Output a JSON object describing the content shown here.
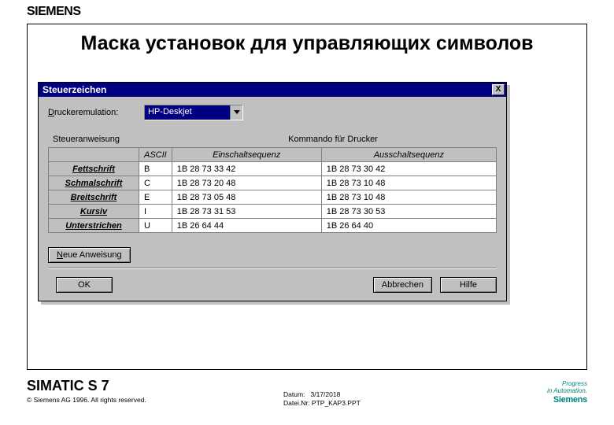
{
  "brand": "SIEMENS",
  "slide_title": "Маска установок для управляющих символов",
  "dialog": {
    "title": "Steuerzeichen",
    "close": "X",
    "emulation_label_pre": "D",
    "emulation_label_rest": "ruckeremulation:",
    "emulation_value": "HP-Deskjet",
    "header_left": "Steueranweisung",
    "header_right": "Kommando für Drucker",
    "columns": {
      "ascii": "ASCII",
      "on": "Einschaltsequenz",
      "off": "Ausschaltsequenz"
    },
    "rows": [
      {
        "name": "Fettschrift",
        "ascii": "B",
        "on": "1B 28 73 33 42",
        "off": "1B 28 73 30 42"
      },
      {
        "name": "Schmalschrift",
        "ascii": "C",
        "on": "1B 28 73 20 48",
        "off": "1B 28 73 10 48"
      },
      {
        "name": "Breitschrift",
        "ascii": "E",
        "on": "1B 28 73 05 48",
        "off": "1B 28 73 10 48"
      },
      {
        "name": "Kursiv",
        "ascii": "I",
        "on": "1B 28 73 31 53",
        "off": "1B 28 73 30 53"
      },
      {
        "name": "Unterstrichen",
        "ascii": "U",
        "on": "1B 26 64 44",
        "off": "1B 26 64 40"
      }
    ],
    "btn_new_pre": "N",
    "btn_new_rest": "eue Anweisung",
    "btn_ok": "OK",
    "btn_cancel": "Abbrechen",
    "btn_help": "Hilfe"
  },
  "footer": {
    "product": "SIMATIC S 7",
    "copyright": "© Siemens AG 1996. All rights reserved.",
    "date_lbl": "Datum:",
    "date_val": "3/17/2018",
    "file_lbl": "Datei.Nr:",
    "file_val": "PTP_KAP3.PPT",
    "tag1": "Progress",
    "tag2": "in Automation.",
    "tag3": "Siemens"
  }
}
